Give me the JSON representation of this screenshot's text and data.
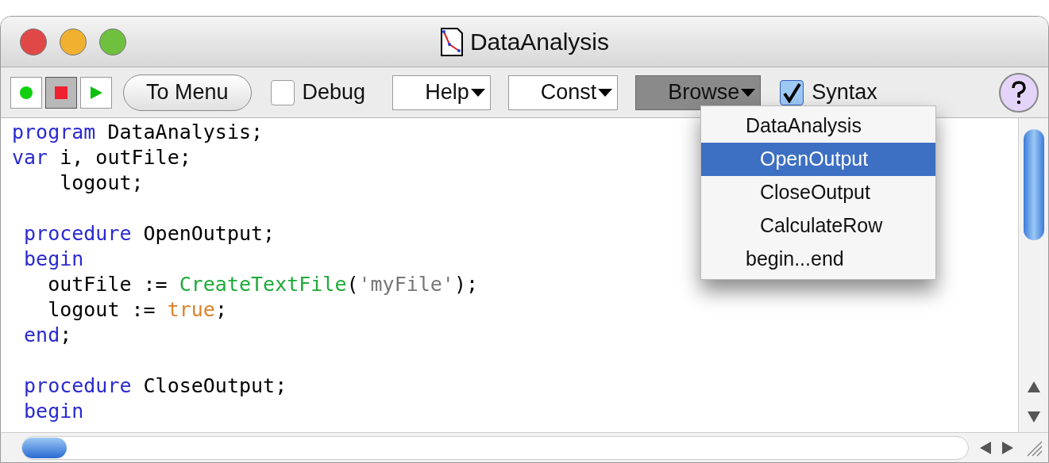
{
  "window": {
    "title": "DataAnalysis"
  },
  "toolbar": {
    "tool_buttons": [
      {
        "selected": false
      },
      {
        "selected": true
      },
      {
        "selected": false
      }
    ],
    "menu_button": {
      "label": "To Menu"
    },
    "debug": {
      "label": "Debug",
      "checked": false
    },
    "popups": [
      {
        "label": "Help",
        "open": false
      },
      {
        "label": "Const",
        "open": false
      },
      {
        "label": "Browse",
        "open": true
      }
    ],
    "syntax": {
      "label": "Syntax",
      "checked": true
    }
  },
  "browse_menu": [
    {
      "label": "DataAnalysis",
      "selected": false,
      "children": [
        {
          "label": "OpenOutput",
          "selected": true
        },
        {
          "label": "CloseOutput",
          "selected": false
        },
        {
          "label": "CalculateRow",
          "selected": false
        }
      ]
    },
    {
      "label": "begin...end",
      "selected": false
    }
  ],
  "code": {
    "blocks": [
      {
        "lines": [
          [
            {
              "kind": "keyword",
              "text": "program"
            },
            {
              "kind": "plain",
              "text": " DataAnalysis;"
            }
          ],
          [
            {
              "kind": "keyword",
              "text": "var"
            },
            {
              "kind": "plain",
              "text": " i, outFile;"
            }
          ],
          [
            {
              "kind": "plain",
              "text": "    logout;"
            }
          ]
        ]
      },
      {
        "lines": [
          [
            {
              "kind": "keyword",
              "text": " procedure"
            },
            {
              "kind": "plain",
              "text": " OpenOutput;"
            }
          ],
          [
            {
              "kind": "keyword",
              "text": " begin"
            }
          ],
          [
            {
              "kind": "plain",
              "text": "   outFile := "
            },
            {
              "kind": "function",
              "text": "CreateTextFile"
            },
            {
              "kind": "plain",
              "text": "("
            },
            {
              "kind": "string",
              "text": "'myFile'"
            },
            {
              "kind": "plain",
              "text": ");"
            }
          ],
          [
            {
              "kind": "plain",
              "text": "   logout := "
            },
            {
              "kind": "literal",
              "text": "true"
            },
            {
              "kind": "plain",
              "text": ";"
            }
          ],
          [
            {
              "kind": "keyword",
              "text": " end"
            },
            {
              "kind": "plain",
              "text": ";"
            }
          ]
        ]
      },
      {
        "lines": [
          [
            {
              "kind": "keyword",
              "text": " procedure"
            },
            {
              "kind": "plain",
              "text": " CloseOutput;"
            }
          ],
          [
            {
              "kind": "keyword",
              "text": " begin"
            }
          ]
        ]
      }
    ]
  }
}
